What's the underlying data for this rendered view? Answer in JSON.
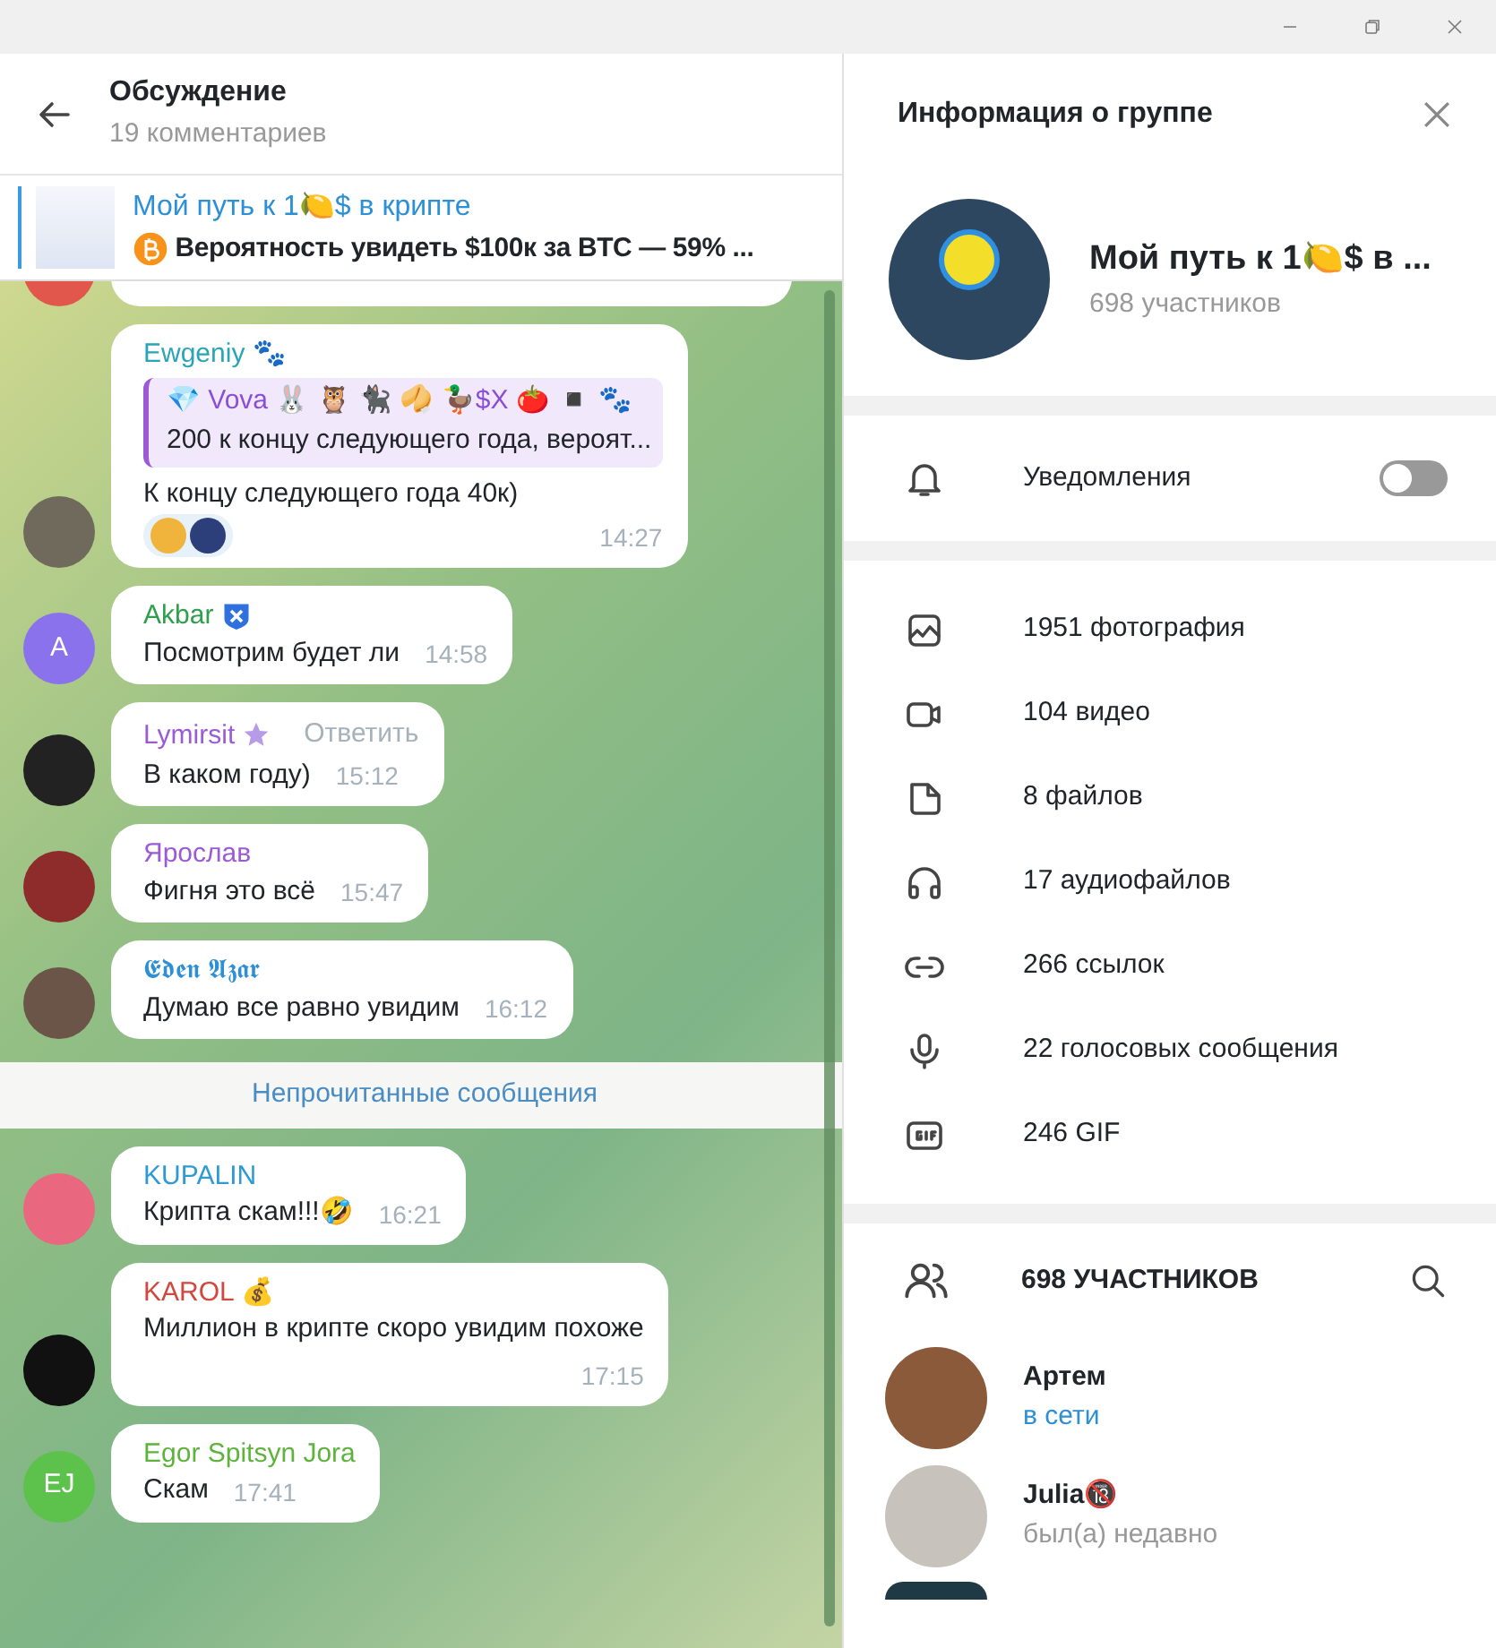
{
  "chat": {
    "title": "Обсуждение",
    "subtitle": "19 комментариев",
    "pinned": {
      "title": "Мой путь к 1🍋$ в крипте",
      "text": "Вероятность увидеть $100к за BTC — 59%  ..."
    },
    "messages": [
      {
        "kind": "cut",
        "avatar": {
          "kind": "photo",
          "color": "#e2574c"
        }
      },
      {
        "kind": "message",
        "author": "Ewgeniy 🐾",
        "color": "#2aa5b5",
        "reply": {
          "author": "💎 Vova 🐰 🦉 🐈‍⬛ 🥠 🦆$X 🍅 ◾ 🐾",
          "text": "200 к концу следующего года, вероят..."
        },
        "text": "К концу следующего года 40к)",
        "time": "14:27",
        "reactions": true,
        "avatar": {
          "kind": "photo",
          "color": "#6f6a5c"
        }
      },
      {
        "kind": "message",
        "author": "Akbar",
        "color": "#2e9f4a",
        "verified": true,
        "text": "Посмотрим будет ли",
        "time": "14:58",
        "avatar": {
          "kind": "initials",
          "initials": "A",
          "color": "#8a72ec"
        }
      },
      {
        "kind": "message",
        "author": "Lymirsit",
        "color": "#9b5bd6",
        "premium": true,
        "action": "Ответить",
        "text": "В каком году)",
        "time": "15:12",
        "avatar": {
          "kind": "photo",
          "color": "#222222"
        }
      },
      {
        "kind": "message",
        "author": "Ярослав",
        "color": "#9b5bd6",
        "text": "Фигня это всё",
        "time": "15:47",
        "avatar": {
          "kind": "photo",
          "color": "#8e2b2b"
        }
      },
      {
        "kind": "message",
        "author": "𝕰𝖉𝖊𝖓 𝕬𝖟𝖆𝖗",
        "color": "#2d8fd6",
        "text": "Думаю все равно увидим",
        "time": "16:12",
        "avatar": {
          "kind": "photo",
          "color": "#6b5548"
        }
      },
      {
        "kind": "divider",
        "text": "Непрочитанные сообщения"
      },
      {
        "kind": "message",
        "author": "KUPALIN",
        "color": "#2d9ad6",
        "text": "Крипта скам!!!🤣",
        "time": "16:21",
        "avatar": {
          "kind": "photo",
          "color": "#e9677f"
        }
      },
      {
        "kind": "message",
        "author": "KAROL 💰",
        "color": "#d2473e",
        "text": "Миллион в крипте скоро увидим похоже",
        "time": "17:15",
        "tall": true,
        "avatar": {
          "kind": "photo",
          "color": "#111111"
        }
      },
      {
        "kind": "message",
        "author": "Egor Spitsyn Jora",
        "color": "#5fb33c",
        "text": "Скам",
        "time": "17:41",
        "avatar": {
          "kind": "initials",
          "initials": "EJ",
          "color": "#5cc24c"
        }
      }
    ]
  },
  "info": {
    "title": "Информация о группе",
    "group_name": "Мой путь к 1🍋$ в ...",
    "group_members": "698 участников",
    "notifications": {
      "label": "Уведомления",
      "on": false
    },
    "media": [
      {
        "kind": "photo",
        "label": "1951 фотография"
      },
      {
        "kind": "video",
        "label": "104 видео"
      },
      {
        "kind": "file",
        "label": "8 файлов"
      },
      {
        "kind": "audio",
        "label": "17 аудиофайлов"
      },
      {
        "kind": "link",
        "label": "266 ссылок"
      },
      {
        "kind": "voice",
        "label": "22 голосовых сообщения"
      },
      {
        "kind": "gif",
        "label": "246 GIF"
      }
    ],
    "members_header": "698 УЧАСТНИКОВ",
    "members": [
      {
        "name": "Артем",
        "status": "в сети",
        "online": true,
        "color": "#8a5a3a"
      },
      {
        "name": "Julia🔞",
        "status": "был(а) недавно",
        "online": false,
        "color": "#c8c2bd"
      }
    ]
  }
}
